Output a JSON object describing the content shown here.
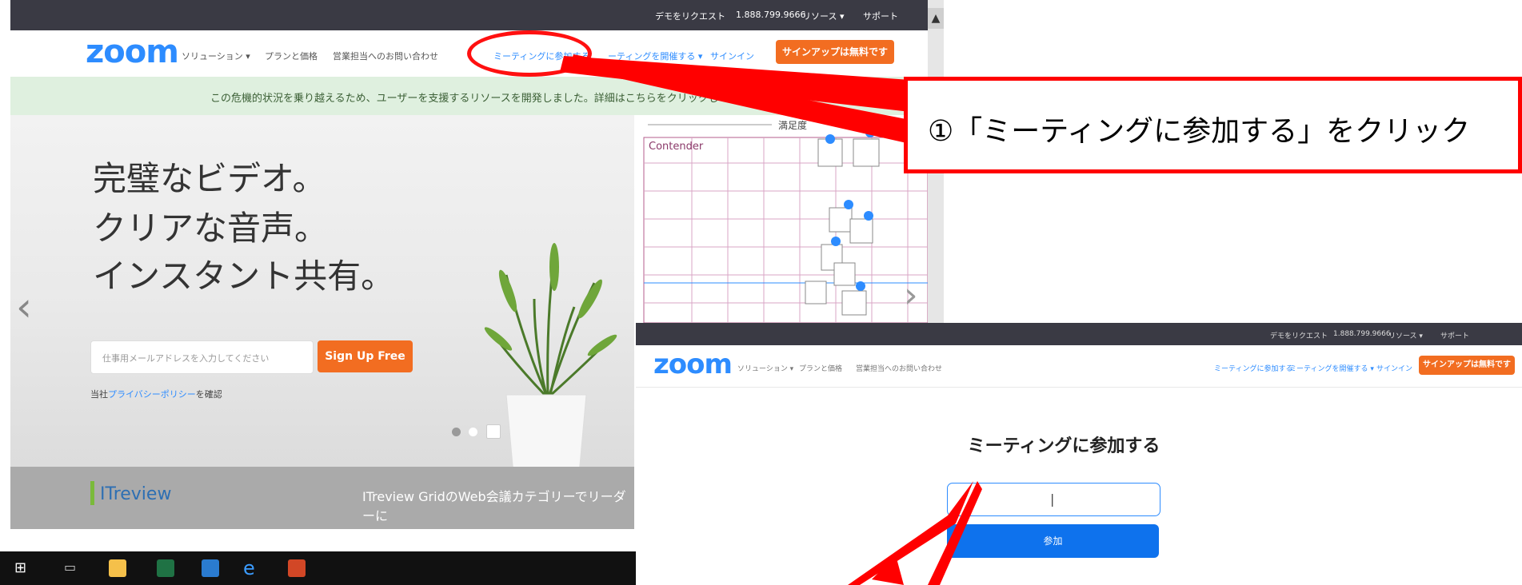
{
  "screen1": {
    "topbar": {
      "demo": "デモをリクエスト",
      "phone": "1.888.799.9666",
      "resources": "リソース ▾",
      "support": "サポート"
    },
    "logo": "zoom",
    "nav": {
      "solutions": "ソリューション ▾",
      "plans": "プランと価格",
      "contact_sales": "営業担当へのお問い合わせ",
      "join": "ミーティングに参加する",
      "host": "ーティングを開催する ▾",
      "signin": "サインイン",
      "signup_free": "サインアップは無料です"
    },
    "banner": "この危機的状況を乗り越えるため、ユーザーを支援するリソースを開発しました。詳細はこちらをクリックしてください。",
    "hero": {
      "line1": "完璧なビデオ。",
      "line2": "クリアな音声。",
      "line3": "インスタント共有。"
    },
    "email_placeholder": "仕事用メールアドレスを入力してください",
    "signup_button": "Sign Up Free",
    "privacy": {
      "prefix": "当社",
      "link": "プライバシーポリシー",
      "suffix": "を確認"
    },
    "grid": {
      "header": "満足度",
      "quadrant": "Contender"
    },
    "itreview": {
      "logo": "ITreview",
      "text": "ITreview GridのWeb会議カテゴリーでリーダーに"
    }
  },
  "screen2": {
    "topbar": {
      "demo": "デモをリクエスト",
      "phone": "1.888.799.9666",
      "resources": "リソース ▾",
      "support": "サポート"
    },
    "logo": "zoom",
    "nav": {
      "solutions": "ソリューション ▾",
      "plans": "プランと価格",
      "contact_sales": "営業担当へのお問い合わせ",
      "join": "ミーティングに参加する",
      "host": "ミーティングを開催する ▾",
      "signin": "サインイン",
      "signup_free": "サインアップは無料です"
    },
    "title": "ミーティングに参加する",
    "input_value": "|",
    "join_button": "参加"
  },
  "callout": "①「ミーティングに参加する」をクリック",
  "colors": {
    "brand": "#2d8cff",
    "accent": "#f26d21",
    "annotation": "#ff0000"
  }
}
